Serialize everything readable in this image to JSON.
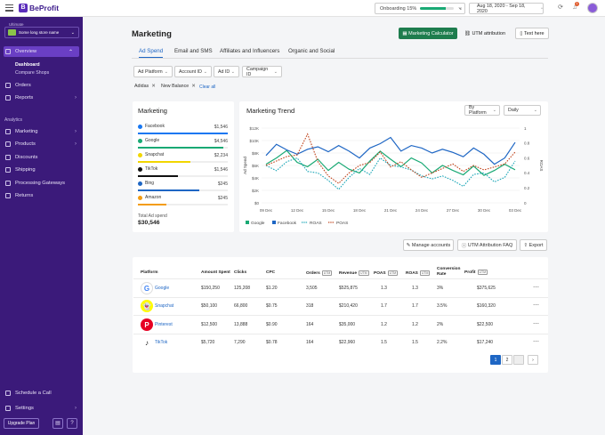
{
  "app": {
    "name": "BeProfit",
    "logo_letter": "B"
  },
  "topbar": {
    "onboarding_label": "Onboarding",
    "onboarding_pct_label": "15%",
    "onboarding_progress": 0.75,
    "date_range": "Aug 18, 2020  -  Sep 18, 2020",
    "notifications_count": "1"
  },
  "sidebar": {
    "plan": "Ultimate",
    "store_name": "Some long store name",
    "overview": "Overview",
    "sub_dashboard": "Dashboard",
    "sub_compare": "Compare Shops",
    "orders": "Orders",
    "reports": "Reports",
    "analytics_heading": "Analytics",
    "marketing": "Marketing",
    "products": "Products",
    "discounts": "Discounts",
    "shipping": "Shipping",
    "gateways": "Processing Gateways",
    "returns": "Returns",
    "schedule_call": "Schedule a Call",
    "settings": "Settings",
    "upgrade": "Upgrade Plan"
  },
  "page": {
    "title": "Marketing",
    "btn_calculator": "Marketing Calculator",
    "btn_utm": "UTM attribution",
    "btn_text": "Text here"
  },
  "tabs": [
    "Ad Spend",
    "Email and SMS",
    "Affiliates and Influencers",
    "Organic and Social"
  ],
  "filters": [
    "Ad Platform",
    "Account ID",
    "Ad ID",
    "Campaign ID"
  ],
  "chips": [
    "Adidas",
    "New Balance"
  ],
  "clear_all": "Clear all",
  "marketing_card": {
    "title": "Marketing",
    "platforms": [
      {
        "name": "Facebook",
        "value": "$1,546",
        "color": "#1877f2",
        "fill": 1.0
      },
      {
        "name": "Google",
        "value": "$4,546",
        "color": "#19a974",
        "fill": 0.95
      },
      {
        "name": "Snapchat",
        "value": "$2,234",
        "color": "#f2d600",
        "fill": 0.58
      },
      {
        "name": "TikTok",
        "value": "$1,546",
        "color": "#111111",
        "fill": 0.45
      },
      {
        "name": "Bing",
        "value": "$245",
        "color": "#1e66c4",
        "fill": 0.68
      },
      {
        "name": "Amazon",
        "value": "$245",
        "color": "#f39c12",
        "fill": 0.32
      }
    ],
    "total_label": "Total Ad spend",
    "total_value": "$30,546"
  },
  "trend_card": {
    "title": "Marketing Trend",
    "select_platform": "By Platform",
    "select_period": "Daily"
  },
  "chart_data": {
    "type": "line",
    "title": "Marketing Trend",
    "ylabel": "Ad Spend",
    "y2label": "ROAS",
    "y_ticks": [
      "$0",
      "$2K",
      "$4K",
      "$6K",
      "$8K",
      "$10K",
      "$12K"
    ],
    "y2_ticks": [
      "0",
      "0.2",
      "0.4",
      "0.6",
      "0.8",
      "1"
    ],
    "ylim": [
      0,
      12000
    ],
    "y2lim": [
      0,
      1
    ],
    "x": [
      "09 Dec",
      "12 Dec",
      "15 Dec",
      "18 Dec",
      "21 Dec",
      "24 Dec",
      "27 Dec",
      "30 Dec",
      "03 Dec"
    ],
    "series": [
      {
        "name": "Google",
        "axis": "left",
        "color": "#19a974",
        "style": "solid",
        "values": [
          6200,
          7200,
          8400,
          6500,
          5800,
          7000,
          5200,
          6500,
          5400,
          4800,
          6700,
          8300,
          7000,
          5800,
          7200,
          6400,
          4800,
          6000,
          5200,
          4500,
          5900,
          4400,
          5200,
          6200,
          5300
        ]
      },
      {
        "name": "Facebook",
        "axis": "left",
        "color": "#1e66c4",
        "style": "solid",
        "values": [
          7600,
          9400,
          8500,
          7800,
          8600,
          9000,
          8200,
          9200,
          8300,
          7200,
          8800,
          9500,
          10500,
          8300,
          9200,
          8800,
          8000,
          8600,
          8100,
          7400,
          8800,
          7800,
          6200,
          7200,
          9700
        ]
      },
      {
        "name": "ROAS",
        "axis": "right",
        "color": "#1aa6b7",
        "style": "dotted",
        "values": [
          0.5,
          0.43,
          0.55,
          0.6,
          0.42,
          0.4,
          0.3,
          0.18,
          0.34,
          0.46,
          0.38,
          0.6,
          0.5,
          0.48,
          0.44,
          0.36,
          0.32,
          0.36,
          0.3,
          0.22,
          0.38,
          0.4,
          0.28,
          0.34,
          0.56
        ]
      },
      {
        "name": "POAS",
        "axis": "right",
        "color": "#c0451d",
        "style": "dotted",
        "values": [
          0.5,
          0.56,
          0.62,
          0.64,
          0.92,
          0.55,
          0.36,
          0.26,
          0.4,
          0.5,
          0.54,
          0.68,
          0.48,
          0.55,
          0.44,
          0.34,
          0.4,
          0.46,
          0.52,
          0.42,
          0.5,
          0.44,
          0.48,
          0.52,
          0.68
        ]
      }
    ]
  },
  "actions": {
    "manage": "Manage accounts",
    "faq": "UTM Attribution FAQ",
    "export": "Export"
  },
  "table": {
    "headers": [
      "Platform",
      "Amount Spent",
      "Clicks",
      "CPC",
      "Orders",
      "Revenue",
      "POAS",
      "ROAS",
      "Conversion Rate",
      "Profit"
    ],
    "utm_tag": "UTM",
    "rows": [
      {
        "platform": "Google",
        "amount": "$150,250",
        "clicks": "125,208",
        "cpc": "$1.20",
        "orders": "3,505",
        "revenue": "$525,875",
        "poas": "1.3",
        "roas": "1.3",
        "conv": "3%",
        "profit": "$375,625"
      },
      {
        "platform": "Snapchat",
        "amount": "$50,100",
        "clicks": "66,800",
        "cpc": "$0.75",
        "orders": "318",
        "revenue": "$210,420",
        "poas": "1.7",
        "roas": "1.7",
        "conv": "3.5%",
        "profit": "$160,320"
      },
      {
        "platform": "Pinterest",
        "amount": "$12,500",
        "clicks": "13,888",
        "cpc": "$0.90",
        "orders": "164",
        "revenue": "$35,000",
        "poas": "1.2",
        "roas": "1.2",
        "conv": "2%",
        "profit": "$22,500"
      },
      {
        "platform": "TikTok",
        "amount": "$5,720",
        "clicks": "7,290",
        "cpc": "$0.78",
        "orders": "164",
        "revenue": "$22,960",
        "poas": "1.5",
        "roas": "1.5",
        "conv": "2.2%",
        "profit": "$17,240"
      }
    ],
    "pages": [
      "1",
      "2",
      "",
      "›"
    ]
  }
}
